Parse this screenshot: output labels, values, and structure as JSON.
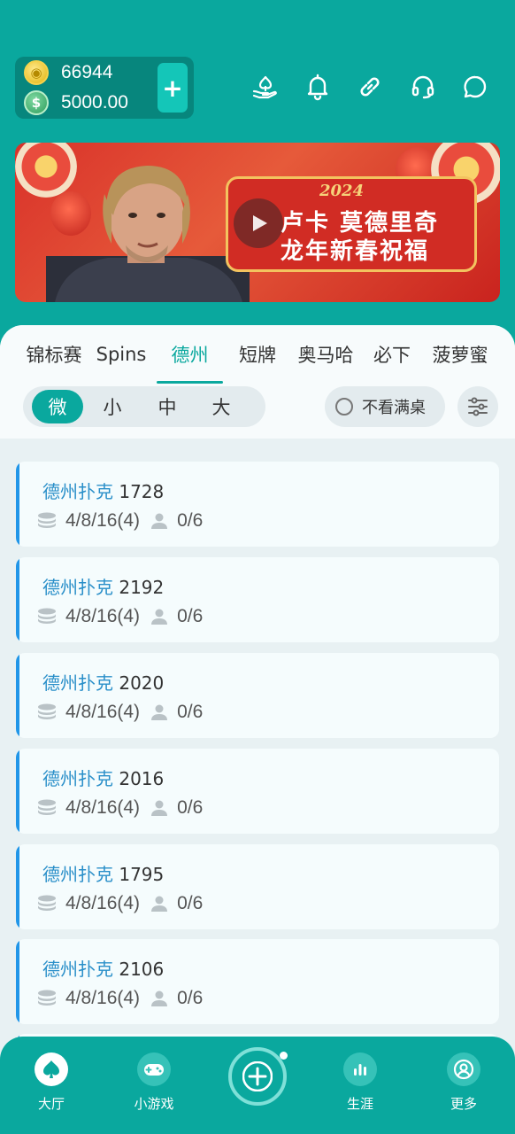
{
  "wallet": {
    "coins": "66944",
    "cash": "5000.00",
    "add_label": "+"
  },
  "top_icons": [
    "poker-hand-icon",
    "bell-icon",
    "link-icon",
    "headset-icon",
    "chat-icon"
  ],
  "banner": {
    "year": "2024",
    "line1": "卢卡 莫德里奇",
    "line2": "龙年新春祝福"
  },
  "tabs": [
    "锦标赛",
    "Spins",
    "德州",
    "短牌",
    "奥马哈",
    "必下",
    "菠萝蜜"
  ],
  "active_tab": "德州",
  "stakes": [
    "微",
    "小",
    "中",
    "大"
  ],
  "active_stake": "微",
  "hide_full_label": "不看满桌",
  "tables": [
    {
      "name": "德州扑克",
      "number": "1728",
      "blinds": "4/8/16(4)",
      "seats": "0/6"
    },
    {
      "name": "德州扑克",
      "number": "2192",
      "blinds": "4/8/16(4)",
      "seats": "0/6"
    },
    {
      "name": "德州扑克",
      "number": "2020",
      "blinds": "4/8/16(4)",
      "seats": "0/6"
    },
    {
      "name": "德州扑克",
      "number": "2016",
      "blinds": "4/8/16(4)",
      "seats": "0/6"
    },
    {
      "name": "德州扑克",
      "number": "1795",
      "blinds": "4/8/16(4)",
      "seats": "0/6"
    },
    {
      "name": "德州扑克",
      "number": "2106",
      "blinds": "4/8/16(4)",
      "seats": "0/6"
    }
  ],
  "nav": {
    "lobby": "大厅",
    "minigames": "小游戏",
    "career": "生涯",
    "more": "更多"
  },
  "colors": {
    "primary": "#0aa89e",
    "accent_blue": "#2196e8",
    "panel_bg": "#e8f1f3"
  }
}
